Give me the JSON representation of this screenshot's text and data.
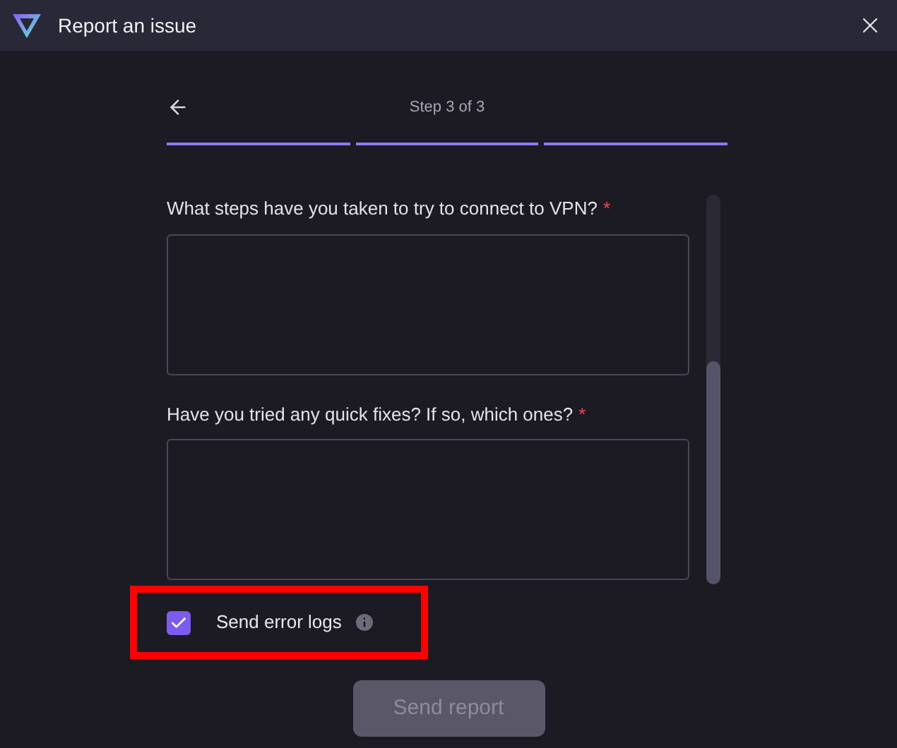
{
  "window": {
    "title": "Report an issue"
  },
  "stepper": {
    "label": "Step 3 of 3",
    "steps": [
      {
        "done": true
      },
      {
        "done": true
      },
      {
        "done": true
      }
    ]
  },
  "questions": [
    {
      "label": "What steps have you taken to try to connect to VPN?",
      "required": true,
      "required_mark": "*"
    },
    {
      "label": "Have you tried any quick fixes? If so, which ones?",
      "required": true,
      "required_mark": "*"
    }
  ],
  "send_logs": {
    "label": "Send error logs",
    "checked": true,
    "highlighted": true
  },
  "submit": {
    "label": "Send report",
    "disabled": true
  }
}
